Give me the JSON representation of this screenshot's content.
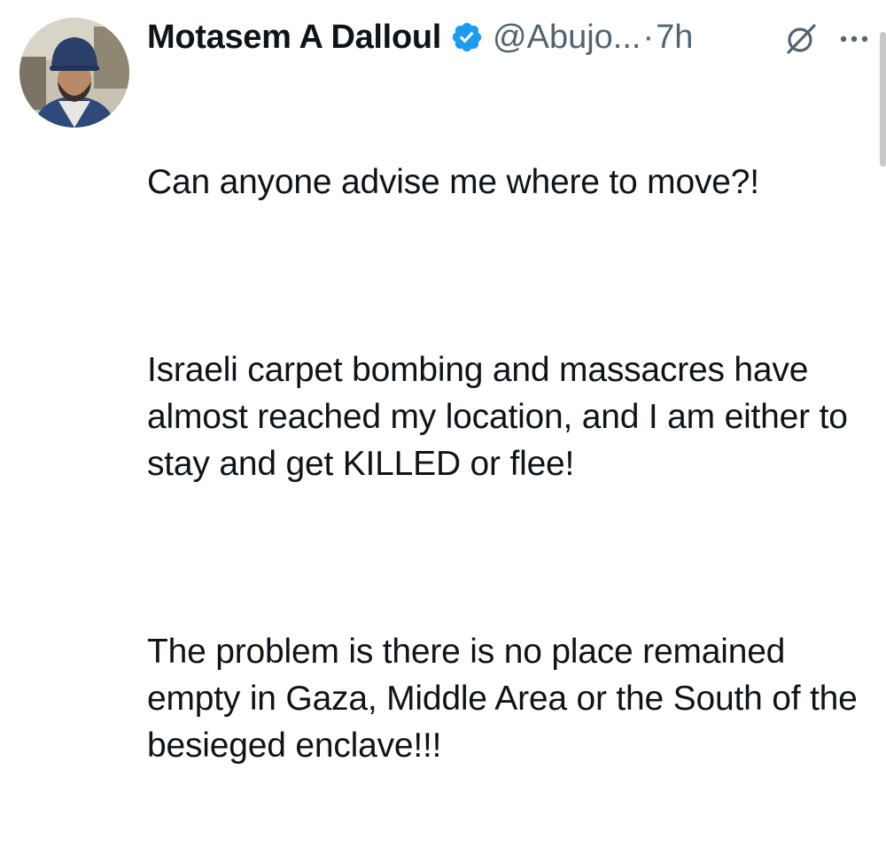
{
  "author": {
    "display_name": "Motasem A Dalloul",
    "handle": "@Abujo...",
    "separator": "·",
    "time": "7h",
    "verified": true,
    "verified_color": "#1d9bf0"
  },
  "icons": {
    "avatar": "profile-photo",
    "verified": "verified-badge-icon",
    "grok": "grok-icon",
    "more": "more-icon"
  },
  "tweet": {
    "paragraphs": [
      "Can anyone advise me where to move?!",
      "Israeli carpet bombing and massacres have almost reached my location, and I am either to stay and get KILLED or flee!",
      "The problem is there is no place remained empty in Gaza, Middle Area or the South of the besieged enclave!!!"
    ]
  }
}
